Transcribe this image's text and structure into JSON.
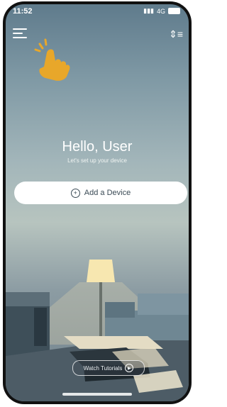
{
  "status_bar": {
    "time": "11:52",
    "network": "4G"
  },
  "header": {
    "menu_icon": "menu-icon",
    "sort_icon": "sort-icon"
  },
  "hand_hint": {
    "icon": "pointing-hand-icon",
    "color": "#E8A72A"
  },
  "greeting": {
    "title": "Hello, User",
    "subtitle": "Let's set up your device"
  },
  "add_device": {
    "label": "Add a Device",
    "icon": "plus-icon"
  },
  "tutorials": {
    "label": "Watch Tutorials",
    "icon": "play-icon"
  }
}
